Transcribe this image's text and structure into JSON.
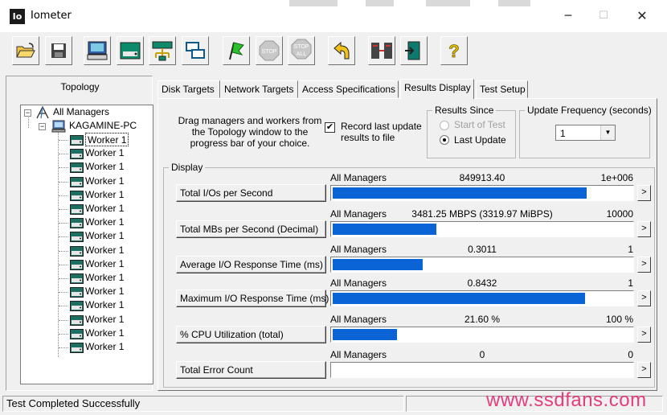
{
  "window": {
    "title": "Iometer",
    "icon_text": "Io",
    "controls": {
      "minimize": "─",
      "maximize": "☐",
      "close": "✕"
    }
  },
  "toolbar": {
    "buttons": [
      {
        "name": "open-config",
        "icon": "folder-open-icon"
      },
      {
        "name": "save-config",
        "icon": "floppy-disk-icon"
      },
      {
        "name": "start-new-disk-worker",
        "icon": "disk-worker-icon"
      },
      {
        "name": "start-new-network-worker",
        "icon": "network-worker-icon"
      },
      {
        "name": "start-new-manager",
        "icon": "manager-icon"
      },
      {
        "name": "duplicate-worker",
        "icon": "duplicate-icon"
      },
      {
        "name": "start-tests",
        "icon": "green-flag-icon"
      },
      {
        "name": "stop",
        "icon": "stop-sign-icon",
        "label": "STOP",
        "disabled": true
      },
      {
        "name": "stop-all",
        "icon": "stop-all-icon",
        "label": "STOP",
        "label2": "ALL",
        "disabled": true
      },
      {
        "name": "reset-workers",
        "icon": "undo-arrow-icon"
      },
      {
        "name": "exit",
        "icon": "exit-door-icon"
      },
      {
        "name": "about",
        "icon": "help-question-icon",
        "label": "?"
      }
    ]
  },
  "topology": {
    "title": "Topology",
    "root": "All Managers",
    "manager": "KAGAMINE-PC",
    "workers": [
      "Worker 1",
      "Worker 1",
      "Worker 1",
      "Worker 1",
      "Worker 1",
      "Worker 1",
      "Worker 1",
      "Worker 1",
      "Worker 1",
      "Worker 1",
      "Worker 1",
      "Worker 1",
      "Worker 1",
      "Worker 1",
      "Worker 1",
      "Worker 1"
    ]
  },
  "tabs": [
    {
      "label": "Disk Targets"
    },
    {
      "label": "Network Targets"
    },
    {
      "label": "Access Specifications"
    },
    {
      "label": "Results Display",
      "active": true
    },
    {
      "label": "Test Setup"
    }
  ],
  "results": {
    "drag_text": "Drag managers and workers from the Topology window to the progress bar of your choice.",
    "record_checked": true,
    "record_mark": "✔",
    "record_label": "Record last update results to file",
    "results_since": {
      "title": "Results Since",
      "options": [
        "Start of Test",
        "Last Update"
      ],
      "selected": "Last Update"
    },
    "update_frequency": {
      "title": "Update Frequency (seconds)",
      "value": "1",
      "arrow": "▼"
    },
    "display_title": "Display",
    "arrow_label": ">",
    "metrics": [
      {
        "button": "Total I/Os per Second",
        "source": "All Managers",
        "value": "849913.40",
        "max": "1e+006",
        "fill": 0.85
      },
      {
        "button": "Total MBs per Second (Decimal)",
        "source": "All Managers",
        "value": "3481.25 MBPS (3319.97 MiBPS)",
        "max": "10000",
        "fill": 0.348
      },
      {
        "button": "Average I/O Response Time (ms)",
        "source": "All Managers",
        "value": "0.3011",
        "max": "1",
        "fill": 0.301
      },
      {
        "button": "Maximum I/O Response Time (ms)",
        "source": "All Managers",
        "value": "0.8432",
        "max": "1",
        "fill": 0.8432
      },
      {
        "button": "% CPU Utilization (total)",
        "source": "All Managers",
        "value": "21.60 %",
        "max": "100 %",
        "fill": 0.216
      },
      {
        "button": "Total Error Count",
        "source": "All Managers",
        "value": "0",
        "max": "0",
        "fill": 0
      }
    ]
  },
  "status": {
    "text": "Test Completed Successfully"
  },
  "watermark": "www.ssdfans.com",
  "colors": {
    "bar": "#0a64d6",
    "watermark": "#e0206a"
  }
}
